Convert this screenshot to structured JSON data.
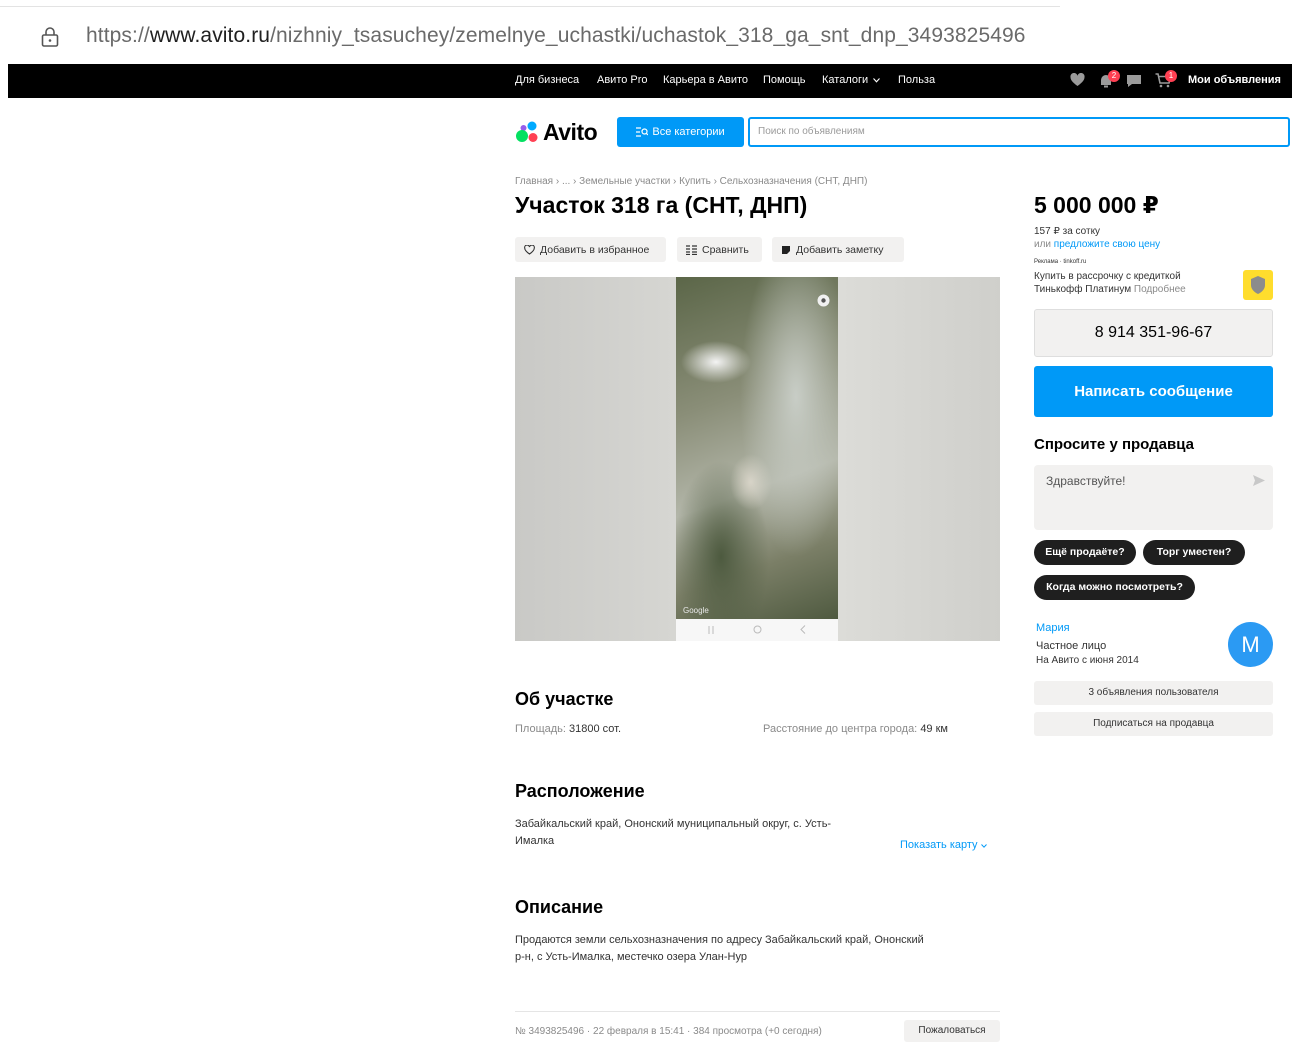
{
  "browser": {
    "url_prefix": "https://",
    "url_domain": "www.avito.ru",
    "url_path": "/nizhniy_tsasuchey/zemelnye_uchastki/uchastok_318_ga_snt_dnp_3493825496"
  },
  "topnav": {
    "links": [
      "Для бизнеса",
      "Авито Pro",
      "Карьера в Авито",
      "Помощь",
      "Каталоги",
      "Польза"
    ],
    "my_ads": "Мои объявления",
    "badge_notifications": "2",
    "badge_cart": "1"
  },
  "header": {
    "logo": "Avito",
    "categories_button": "Все категории",
    "search_placeholder": "Поиск по объявлениям"
  },
  "breadcrumb": "Главная › ... › Земельные участки › Купить › Сельхозназначения (СНТ, ДНП)",
  "listing": {
    "title": "Участок 318 га (СНТ, ДНП)",
    "actions": {
      "favorite": "Добавить в избранное",
      "compare": "Сравнить",
      "note": "Добавить заметку"
    },
    "gallery": {
      "watermark": "Google"
    },
    "about": {
      "heading": "Об участке",
      "area_label": "Площадь:",
      "area_value": "31800 сот.",
      "distance_label": "Расстояние до центра города:",
      "distance_value": "49 км"
    },
    "location": {
      "heading": "Расположение",
      "address_line1": "Забайкальский край, Ононский муниципальный округ, с. Усть-",
      "address_line2": "Ималка",
      "show_map": "Показать карту"
    },
    "description": {
      "heading": "Описание",
      "line1": "Продаются земли сельхозназначения по адресу Забайкальский край, Ононский",
      "line2": "р-н, с Усть-Ималка, местечко озера Улан-Нур"
    },
    "footer": {
      "meta": "№ 3493825496 · 22 февраля в 15:41 · 384 просмотра (+0 сегодня)",
      "complain": "Пожаловаться"
    }
  },
  "sidebar": {
    "price": "5 000 000 ₽",
    "price_per_unit": "157 ₽ за сотку",
    "offer_prefix": "или",
    "offer_link": "предложите свою цену",
    "ad_label": "Реклама · tinkoff.ru",
    "credit_line1": "Купить в рассрочку с кредиткой",
    "credit_line2": "Тинькофф Платинум",
    "credit_more": "Подробнее",
    "phone": "8 914 351-96-67",
    "write_message": "Написать сообщение",
    "ask_title": "Спросите у продавца",
    "ask_placeholder": "Здравствуйте!",
    "chips": [
      "Ещё продаёте?",
      "Торг уместен?",
      "Когда можно посмотреть?"
    ],
    "seller": {
      "name": "Мария",
      "type": "Частное лицо",
      "since": "На Авито с июня 2014",
      "avatar_letter": "M"
    },
    "user_ads": "3 объявления пользователя",
    "subscribe": "Подписаться на продавца"
  },
  "colors": {
    "accent": "#0099f7",
    "nav_bg": "#000000",
    "button_gray": "#f2f1f0"
  }
}
